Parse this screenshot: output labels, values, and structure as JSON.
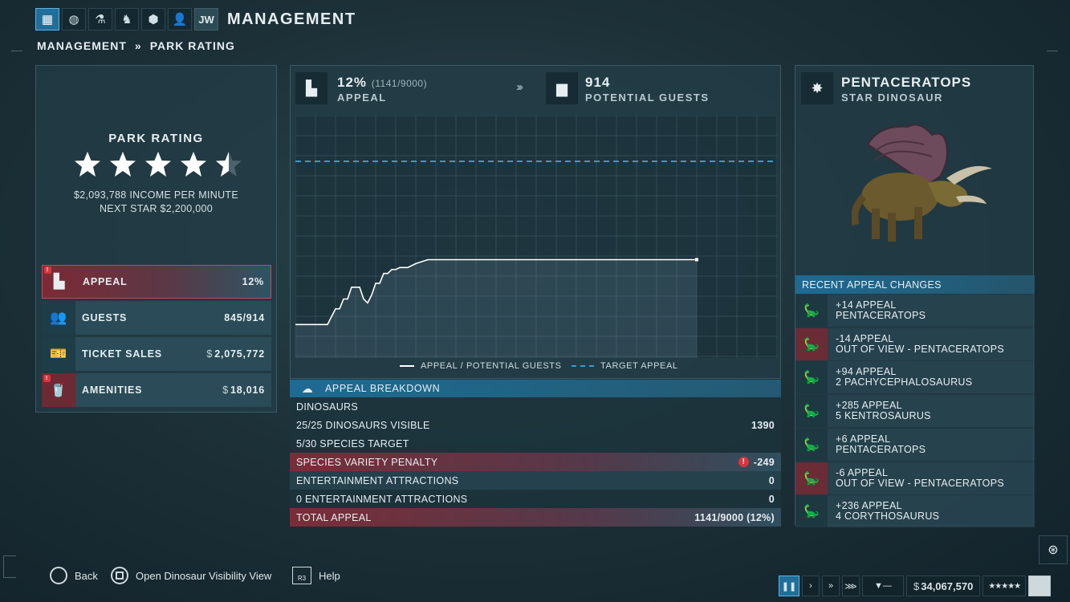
{
  "topbar": {
    "icons": [
      "management-icon",
      "globe-icon",
      "science-icon",
      "dinosaur-icon",
      "hexagons-icon",
      "person-icon",
      "jw-logo"
    ],
    "jw_label": "JW",
    "title": "MANAGEMENT"
  },
  "breadcrumb": {
    "parent": "MANAGEMENT",
    "separator": "»",
    "current": "PARK RATING"
  },
  "park_rating": {
    "title": "PARK RATING",
    "stars_filled": 4.5,
    "stars_total": 5,
    "income": "$2,093,788 INCOME PER MINUTE",
    "next_star": "NEXT STAR $2,200,000"
  },
  "stats": [
    {
      "label": "APPEAL",
      "value": "12%",
      "currency": "",
      "icon": "tower-icon",
      "warning": true,
      "highlight": true
    },
    {
      "label": "GUESTS",
      "value": "845/914",
      "currency": "",
      "icon": "guests-icon",
      "warning": false,
      "highlight": false
    },
    {
      "label": "TICKET SALES",
      "value": "2,075,772",
      "currency": "$",
      "icon": "ticket-icon",
      "warning": false,
      "highlight": false
    },
    {
      "label": "AMENITIES",
      "value": "18,016",
      "currency": "$",
      "icon": "drink-food-icon",
      "warning": true,
      "highlight": false
    }
  ],
  "appeal_header": {
    "percent": "12%",
    "detail": "(1141/9000)",
    "label": "APPEAL",
    "guests": "914",
    "guests_label": "POTENTIAL GUESTS"
  },
  "chart_data": {
    "type": "line",
    "series": [
      {
        "name": "APPEAL / POTENTIAL GUESTS",
        "x": [
          0,
          8,
          9,
          10,
          11,
          12,
          13,
          14,
          15,
          16,
          17,
          18,
          19,
          20,
          21,
          22,
          23,
          24,
          25,
          26,
          28,
          30,
          33,
          40,
          50,
          60,
          70,
          80,
          90,
          100
        ],
        "values": [
          0.17,
          0.17,
          0.21,
          0.25,
          0.25,
          0.3,
          0.3,
          0.36,
          0.36,
          0.36,
          0.3,
          0.28,
          0.32,
          0.38,
          0.38,
          0.43,
          0.43,
          0.45,
          0.45,
          0.46,
          0.46,
          0.48,
          0.5,
          0.5,
          0.5,
          0.5,
          0.5,
          0.5,
          0.5,
          0.5
        ]
      },
      {
        "name": "TARGET APPEAL",
        "values": [
          1.0
        ]
      }
    ],
    "xlim": [
      0,
      120
    ],
    "ylim": [
      0,
      1.2
    ],
    "grid": true,
    "legend": "bottom"
  },
  "legend": {
    "appeal": "APPEAL / POTENTIAL GUESTS",
    "target": "TARGET APPEAL"
  },
  "breakdown": {
    "title": "APPEAL BREAKDOWN",
    "rows": [
      {
        "label": "DINOSAURS",
        "value": "",
        "style": "dark",
        "warn": false
      },
      {
        "label": "25/25 DINOSAURS VISIBLE",
        "value": "1390",
        "style": "dark",
        "warn": false
      },
      {
        "label": "5/30 SPECIES TARGET",
        "value": "",
        "style": "dark",
        "warn": false
      },
      {
        "label": "SPECIES VARIETY PENALTY",
        "value": "-249",
        "style": "red",
        "warn": true
      },
      {
        "label": "ENTERTAINMENT ATTRACTIONS",
        "value": "0",
        "style": "lite",
        "warn": false
      },
      {
        "label": "0 ENTERTAINMENT ATTRACTIONS",
        "value": "0",
        "style": "dark",
        "warn": false
      },
      {
        "label": "TOTAL APPEAL",
        "value": "1141/9000 (12%)",
        "style": "red",
        "warn": false
      }
    ]
  },
  "star_dinosaur": {
    "name": "PENTACERATOPS",
    "label": "STAR DINOSAUR"
  },
  "recent_changes": {
    "title": "RECENT APPEAL CHANGES",
    "items": [
      {
        "line1": "+14 APPEAL",
        "line2": "PENTACERATOPS",
        "negative": false
      },
      {
        "line1": "-14 APPEAL",
        "line2": "OUT OF VIEW - PENTACERATOPS",
        "negative": true
      },
      {
        "line1": "+94 APPEAL",
        "line2": "2 PACHYCEPHALOSAURUS",
        "negative": false
      },
      {
        "line1": "+285 APPEAL",
        "line2": "5 KENTROSAURUS",
        "negative": false
      },
      {
        "line1": "+6 APPEAL",
        "line2": "PENTACERATOPS",
        "negative": false
      },
      {
        "line1": "-6 APPEAL",
        "line2": "OUT OF VIEW - PENTACERATOPS",
        "negative": true
      },
      {
        "line1": "+236 APPEAL",
        "line2": "4 CORYTHOSAURUS",
        "negative": false
      }
    ]
  },
  "controls": {
    "back": "Back",
    "visibility": "Open Dinosaur Visibility View",
    "r3": "R3",
    "help": "Help"
  },
  "status_bar": {
    "money_currency": "$",
    "money": "34,067,570",
    "stars": "★★★★★"
  },
  "colors": {
    "accent": "#1f6f9a",
    "warning": "#d9343e",
    "line": "#ffffff",
    "target": "#3a9ad0"
  }
}
